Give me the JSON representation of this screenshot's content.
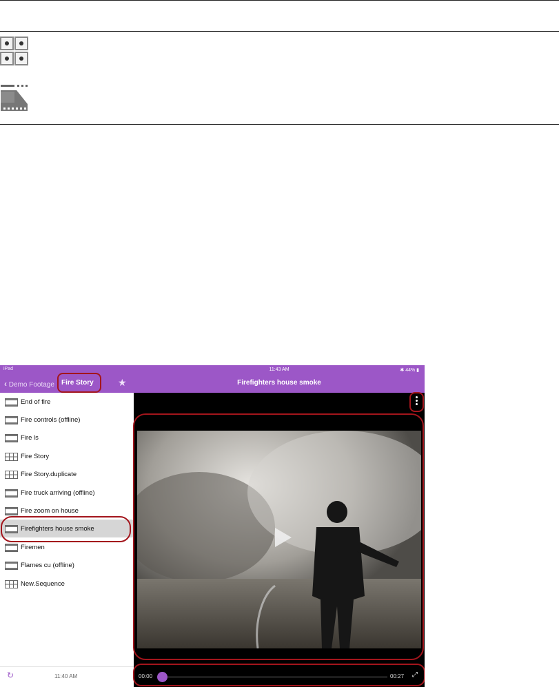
{
  "legend": {
    "grid_icon": "sequence-grid-icon",
    "clip_icon": "clip-film-icon"
  },
  "status_bar": {
    "device": "iPad",
    "time": "11:43 AM",
    "battery": "44%"
  },
  "navigation": {
    "back_label": "Demo Footage",
    "current_folder": "Fire Story",
    "favorite_icon": "star-icon"
  },
  "items": [
    {
      "label": "End of fire",
      "type": "clip"
    },
    {
      "label": "Fire controls (offline)",
      "type": "clip"
    },
    {
      "label": "Fire ls",
      "type": "clip"
    },
    {
      "label": "Fire Story",
      "type": "sequence"
    },
    {
      "label": "Fire Story.duplicate",
      "type": "sequence"
    },
    {
      "label": "Fire truck arriving (offline)",
      "type": "clip"
    },
    {
      "label": "Fire zoom on house",
      "type": "clip"
    },
    {
      "label": "Firefighters house smoke",
      "type": "clip",
      "selected": true
    },
    {
      "label": "Firemen",
      "type": "clip"
    },
    {
      "label": "Flames cu (offline)",
      "type": "clip"
    },
    {
      "label": "New.Sequence",
      "type": "sequence"
    }
  ],
  "footer": {
    "refresh_icon": "refresh-icon",
    "last_updated": "11:40 AM"
  },
  "player": {
    "title": "Firefighters house smoke",
    "current_time": "00:00",
    "duration": "00:27",
    "progress": 0.0,
    "accent": "#9c57c7"
  },
  "annotation_color": "#a3151c"
}
